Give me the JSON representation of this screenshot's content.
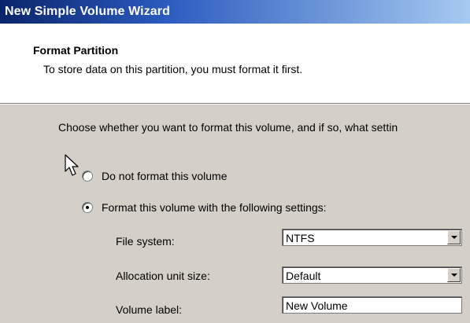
{
  "window": {
    "title": "New Simple Volume Wizard"
  },
  "header": {
    "title": "Format Partition",
    "subtitle": "To store data on this partition, you must format it first."
  },
  "main": {
    "instruction": "Choose whether you want to format this volume, and if so, what settin",
    "options": [
      {
        "label": "Do not format this volume",
        "checked": false
      },
      {
        "label": "Format this volume with the following settings:",
        "checked": true
      }
    ],
    "fields": {
      "file_system": {
        "label": "File system:",
        "value": "NTFS"
      },
      "allocation_unit_size": {
        "label": "Allocation unit size:",
        "value": "Default"
      },
      "volume_label": {
        "label": "Volume label:",
        "value": "New Volume"
      }
    }
  },
  "icons": {
    "cursor": "mouse-pointer-icon",
    "dropdown": "chevron-down-icon"
  },
  "colors": {
    "titlebar_start": "#0a246a",
    "titlebar_end": "#a6caf0",
    "dialog_background": "#d4d0c8",
    "header_background": "#ffffff"
  }
}
